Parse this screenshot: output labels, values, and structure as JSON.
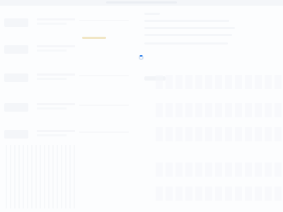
{
  "page": {
    "state": "loading"
  },
  "loading": {
    "label": ""
  }
}
